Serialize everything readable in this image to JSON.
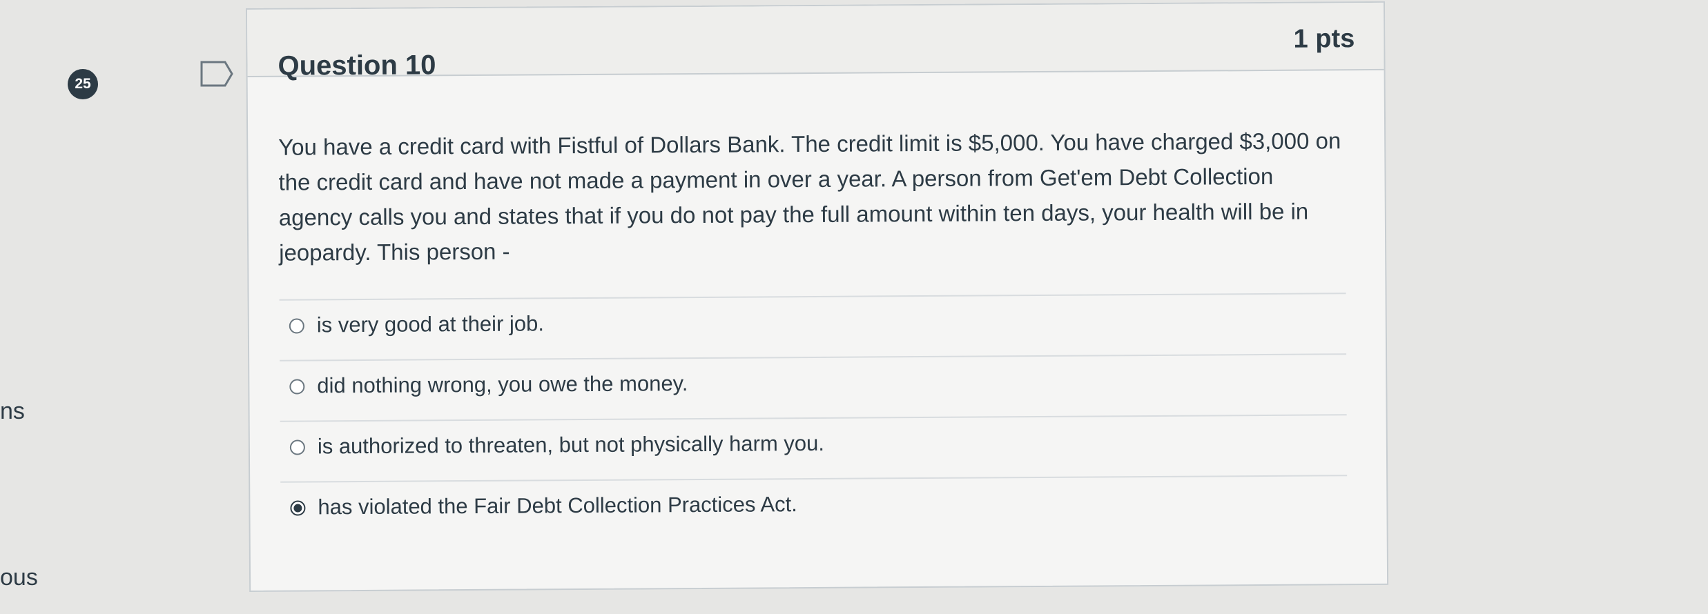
{
  "side_clips": {
    "top": "ns",
    "bottom": "ous"
  },
  "question_badge": "25",
  "question": {
    "title": "Question 10",
    "points": "1 pts",
    "text": "You have a credit card with Fistful of Dollars Bank.  The credit limit is $5,000.  You have charged $3,000 on the credit card and have not made a payment in over a year. A person from Get'em Debt Collection agency calls you and states that if you do not pay the full amount within ten days, your health will be in jeopardy.  This person -",
    "answers": [
      {
        "label": "is very good at their job.",
        "selected": false
      },
      {
        "label": "did nothing wrong, you owe the money.",
        "selected": false
      },
      {
        "label": "is authorized to threaten, but not physically harm you.",
        "selected": false
      },
      {
        "label": "has violated the Fair Debt Collection Practices Act.",
        "selected": true
      }
    ]
  },
  "icons": {
    "flag": "flag-icon"
  },
  "colors": {
    "text": "#2d3b45",
    "card_background": "#f5f5f4",
    "header_background": "#eeeeec",
    "border": "#c7cdd1"
  }
}
